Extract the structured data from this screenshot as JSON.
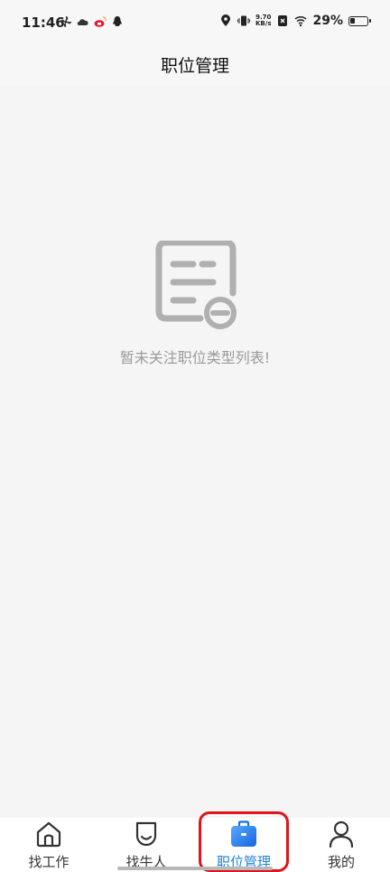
{
  "status_bar": {
    "time": "11:46",
    "net_speed_value": "9.70",
    "net_speed_unit": "KB/s",
    "battery_percent": "29%",
    "battery_level": 0.29
  },
  "header": {
    "title": "职位管理"
  },
  "empty_state": {
    "message": "暂未关注职位类型列表!",
    "icon": "document-remove-icon"
  },
  "tabs": [
    {
      "label": "找工作",
      "icon": "home-icon",
      "active": false
    },
    {
      "label": "找牛人",
      "icon": "face-icon",
      "active": false
    },
    {
      "label": "职位管理",
      "icon": "briefcase-icon",
      "active": true
    },
    {
      "label": "我的",
      "icon": "person-icon",
      "active": false
    }
  ],
  "colors": {
    "accent": "#1b7fd6",
    "highlight": "#e0141c",
    "background": "#f5f5f5",
    "empty_text": "#9a9a9a"
  }
}
